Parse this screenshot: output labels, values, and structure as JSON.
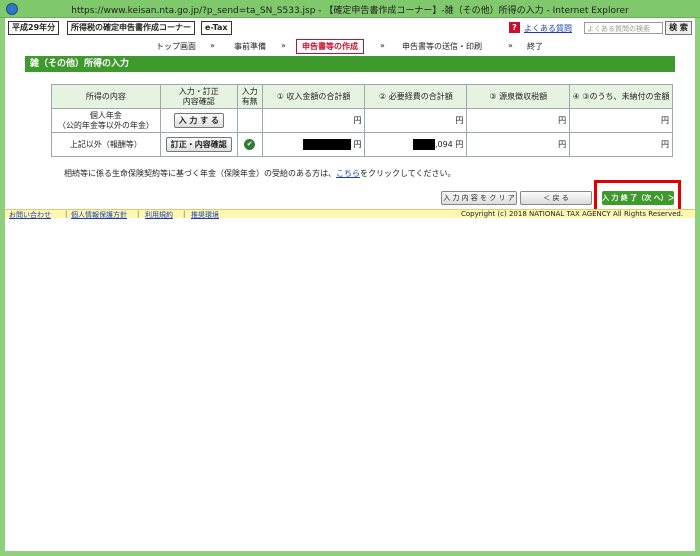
{
  "window": {
    "title": "https://www.keisan.nta.go.jp/?p_send=ta_SN_S533.jsp - 【確定申告書作成コーナー】-雑（その他）所得の入力 - Internet Explorer"
  },
  "topbar": {
    "era": "平成29年分",
    "corner": "所得税の確定申告書作成コーナー",
    "etax": "e-Tax",
    "faq": "よくある質問",
    "search_placeholder": "よくある質問の検索",
    "search_button": "検 索"
  },
  "steps": [
    {
      "label": "トップ画面"
    },
    {
      "label": "事前準備"
    },
    {
      "label": "申告書等の作成",
      "active": true
    },
    {
      "label": "申告書等の送信・印刷"
    },
    {
      "label": "終了"
    }
  ],
  "step_separator": "»",
  "section": {
    "title": "雑（その他）所得の入力"
  },
  "table": {
    "headers": {
      "content": "所得の内容",
      "input_line1": "入力・訂正",
      "input_line2": "内容確認",
      "has_line1": "入力",
      "has_line2": "有無",
      "col1": "① 収入金額の合計額",
      "col2": "② 必要経費の合計額",
      "col3": "③ 源泉徴収税額",
      "col4": "④ ③のうち、未納付の金額"
    },
    "rows": [
      {
        "content_line1": "個人年金",
        "content_line2": "（公的年金等以外の年金）",
        "button": "入 力 す る",
        "col1": "円",
        "col2": "円",
        "col3": "円",
        "col4": "円"
      },
      {
        "content_line1": "上記以外（報酬等）",
        "button": "訂正・内容確認",
        "col1": "円",
        "col2": ",094 円",
        "col3": "円",
        "col4": "円"
      }
    ]
  },
  "note": {
    "before": "相続等に係る生命保険契約等に基づく年金（保険年金）の受給のある方は、",
    "link": "こちら",
    "after": "をクリックしてください。"
  },
  "buttons": {
    "clear": "入 力 内 容 を ク リ ア",
    "back": "＜ 戻 る",
    "finish": "入 力 終 了（次 へ）＞"
  },
  "footer": {
    "links": [
      "お問い合わせ",
      "個人情報保護方針",
      "利用規約",
      "推奨環境"
    ],
    "separator": "|",
    "copyright": "Copyright (c) 2018 NATIONAL TAX AGENCY All Rights Reserved."
  }
}
